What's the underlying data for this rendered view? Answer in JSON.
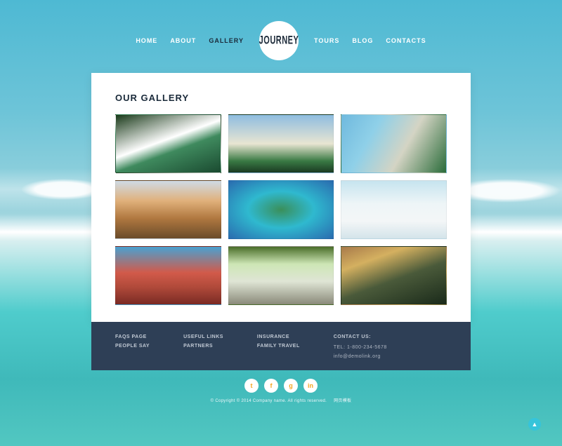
{
  "nav": {
    "items": [
      {
        "label": "HOME"
      },
      {
        "label": "ABOUT"
      },
      {
        "label": "GALLERY",
        "active": true
      },
      {
        "label": "TOURS"
      },
      {
        "label": "BLOG"
      },
      {
        "label": "CONTACTS"
      }
    ],
    "logo": "JOURNEY"
  },
  "gallery": {
    "heading": "OUR GALLERY",
    "tiles": [
      {
        "name": "gallery-tile-waterfall"
      },
      {
        "name": "gallery-tile-temple"
      },
      {
        "name": "gallery-tile-resort"
      },
      {
        "name": "gallery-tile-colosseum"
      },
      {
        "name": "gallery-tile-island"
      },
      {
        "name": "gallery-tile-arctic"
      },
      {
        "name": "gallery-tile-bridge"
      },
      {
        "name": "gallery-tile-eiffel"
      },
      {
        "name": "gallery-tile-mountains"
      }
    ]
  },
  "footer": {
    "col1": [
      "FAQS PAGE",
      "PEOPLE SAY"
    ],
    "col2": [
      "USEFUL LINKS",
      "PARTNERS"
    ],
    "col3": [
      "INSURANCE",
      "FAMILY TRAVEL"
    ],
    "contact": {
      "title": "CONTACT US:",
      "tel": "TEL: 1-800-234-5678",
      "email": "info@demolink.org"
    }
  },
  "socials": [
    {
      "name": "twitter-icon",
      "glyph": "t"
    },
    {
      "name": "facebook-icon",
      "glyph": "f"
    },
    {
      "name": "googleplus-icon",
      "glyph": "g"
    },
    {
      "name": "linkedin-icon",
      "glyph": "in"
    }
  ],
  "copyright": {
    "main": "© Copyright © 2014 Company name. All rights reserved.",
    "extra": "网页模板"
  }
}
